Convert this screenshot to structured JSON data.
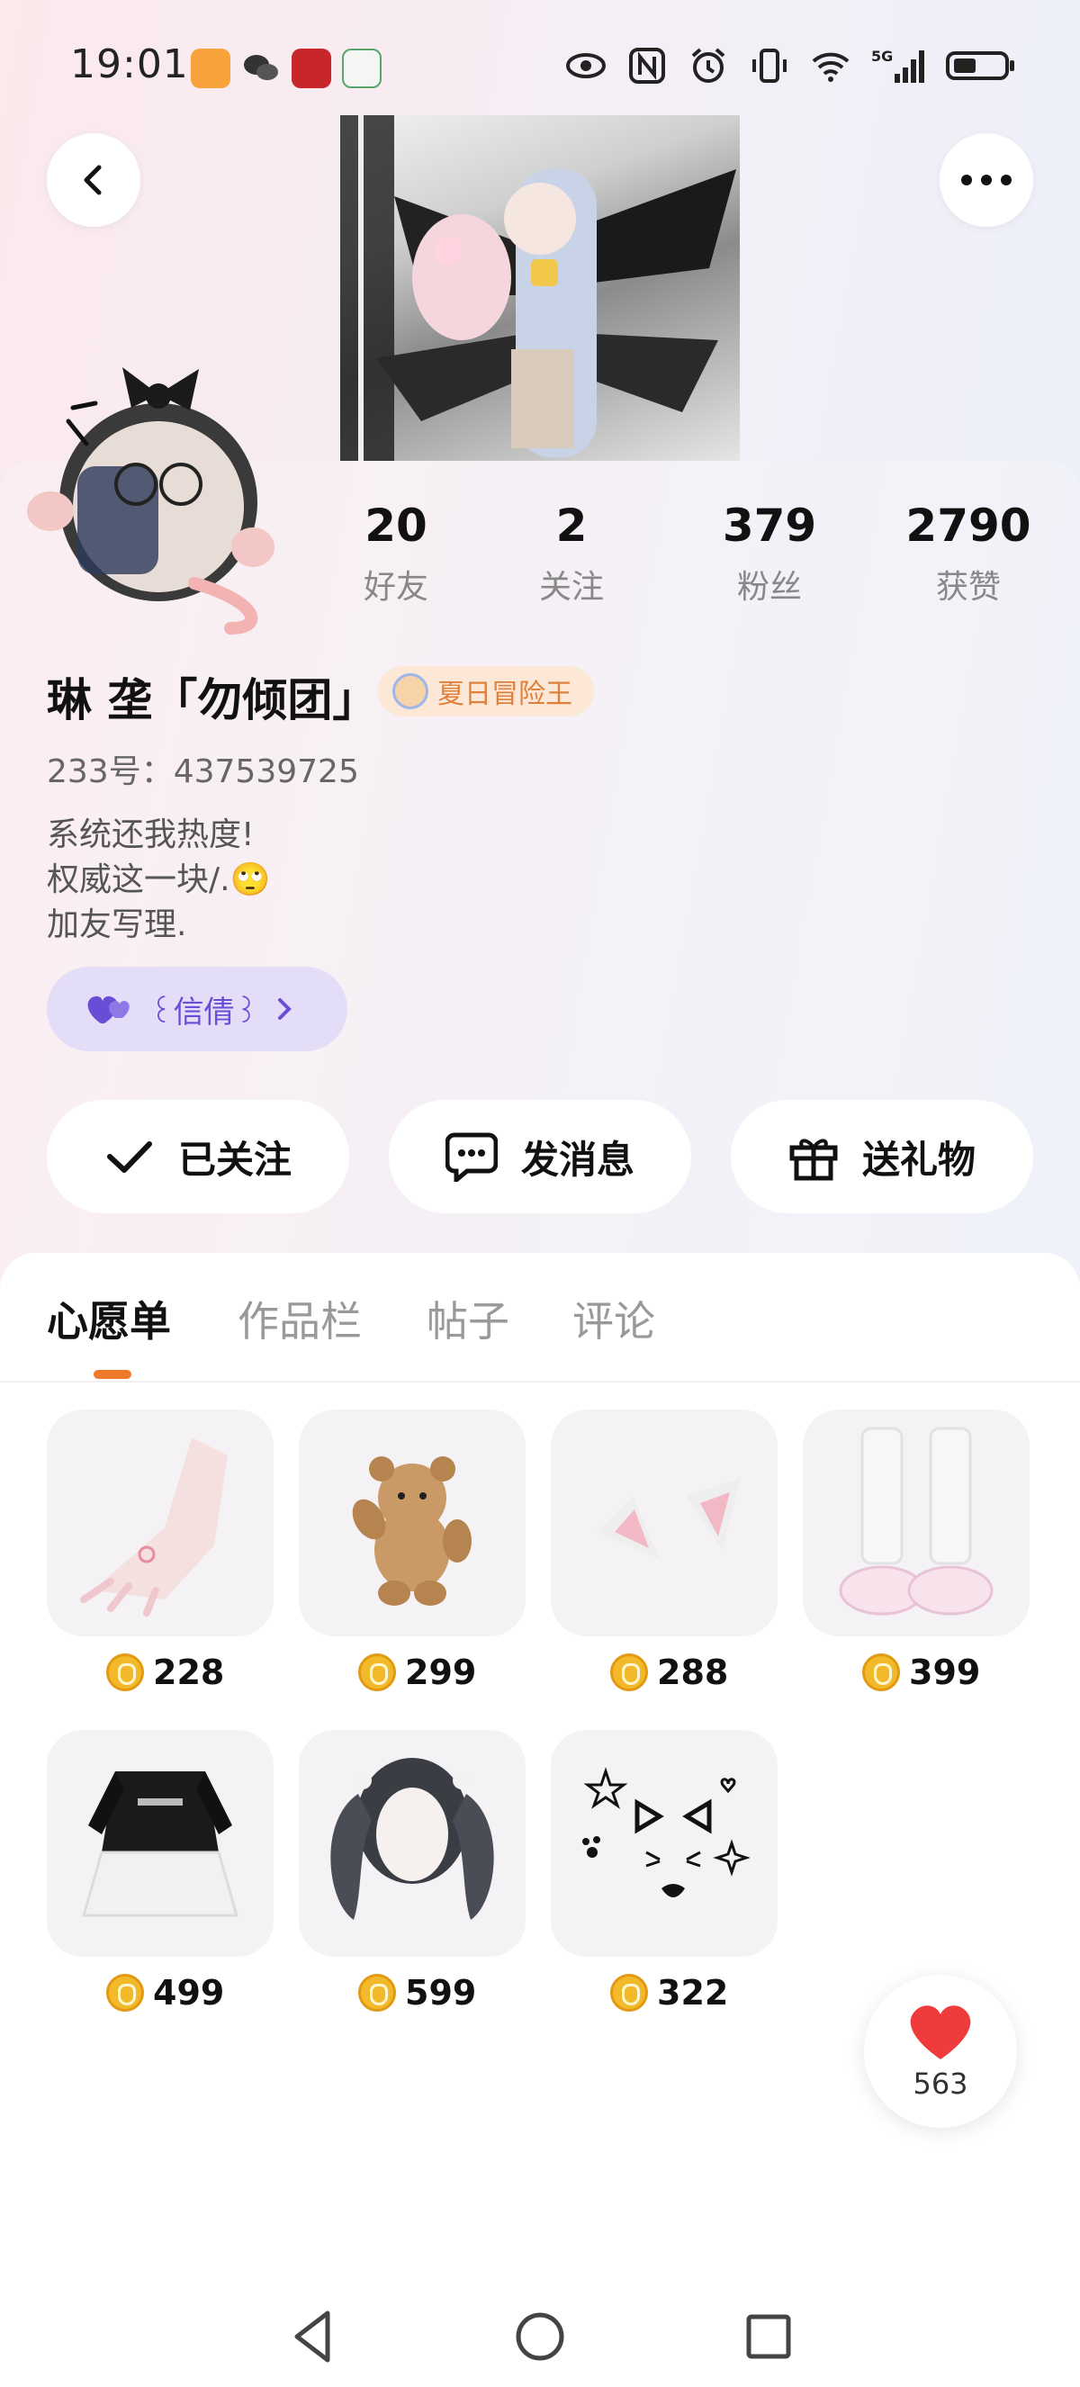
{
  "status_bar": {
    "time": "19:01",
    "icons": [
      "shield-app-icon",
      "wechat-icon",
      "study-app-icon",
      "home-app-icon",
      "eye-icon",
      "nfc-icon",
      "alarm-icon",
      "vibrate-icon",
      "wifi-icon",
      "signal-5g-icon",
      "battery-icon"
    ]
  },
  "header": {
    "back_icon": "back-icon",
    "more_icon": "more-icon"
  },
  "stats": [
    {
      "value": "20",
      "label": "好友"
    },
    {
      "value": "2",
      "label": "关注"
    },
    {
      "value": "379",
      "label": "粉丝"
    },
    {
      "value": "2790",
      "label": "获赞"
    }
  ],
  "profile": {
    "username": "琳 垄「勿倾团」",
    "title_badge": "夏日冒险王",
    "user_id": "233号：437539725",
    "bio": [
      "系统还我热度!",
      "权威这一块/.🙄",
      "加友写理."
    ],
    "intimacy_label": "꒰信倩꒱"
  },
  "actions": {
    "followed": "已关注",
    "message": "发消息",
    "gift": "送礼物"
  },
  "tabs": [
    {
      "label": "心愿单",
      "active": true
    },
    {
      "label": "作品栏",
      "active": false
    },
    {
      "label": "帖子",
      "active": false
    },
    {
      "label": "评论",
      "active": false
    }
  ],
  "wishlist": [
    {
      "item": "hand-item",
      "price": "228"
    },
    {
      "item": "teddy-bear-item",
      "price": "299"
    },
    {
      "item": "cat-ears-item",
      "price": "288"
    },
    {
      "item": "leg-warmers-item",
      "price": "399"
    },
    {
      "item": "dress-item",
      "price": "499"
    },
    {
      "item": "twin-tails-hair-item",
      "price": "599"
    },
    {
      "item": "cat-face-sticker-item",
      "price": "322"
    }
  ],
  "like": {
    "count": "563"
  },
  "colors": {
    "accent": "#f07a2b",
    "like": "#ef3b3b",
    "intimacy": "#6a4dd6",
    "badge": "#e0813b"
  }
}
